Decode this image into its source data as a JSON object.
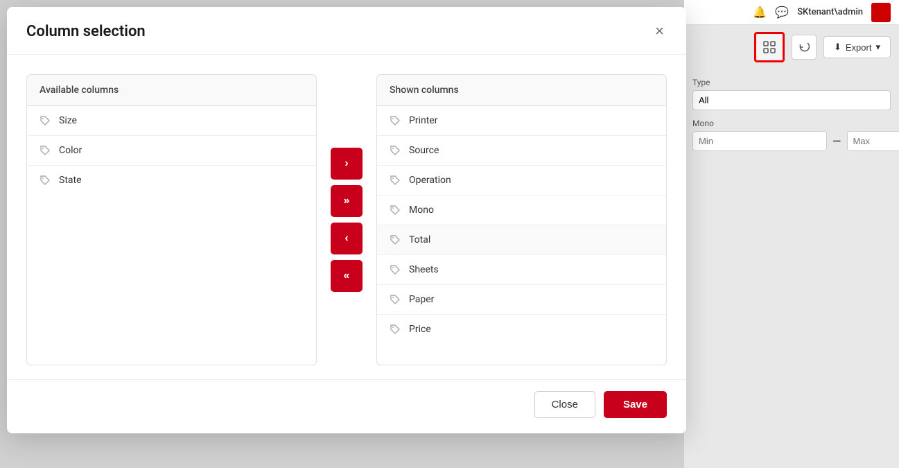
{
  "dialog": {
    "title": "Column selection",
    "close_label": "×"
  },
  "available_columns": {
    "header": "Available columns",
    "items": [
      {
        "label": "Size"
      },
      {
        "label": "Color"
      },
      {
        "label": "State"
      }
    ]
  },
  "shown_columns": {
    "header": "Shown columns",
    "items": [
      {
        "label": "Printer"
      },
      {
        "label": "Source"
      },
      {
        "label": "Operation"
      },
      {
        "label": "Mono"
      },
      {
        "label": "Total"
      },
      {
        "label": "Sheets"
      },
      {
        "label": "Paper"
      },
      {
        "label": "Price"
      }
    ]
  },
  "arrows": {
    "move_right": "›",
    "move_all_right": "»",
    "move_left": "‹",
    "move_all_left": "«"
  },
  "footer": {
    "close_label": "Close",
    "save_label": "Save"
  },
  "bg_panel": {
    "username": "SKtenant\\admin",
    "export_label": "Export",
    "filter_type_label": "Type",
    "filter_type_value": "All",
    "filter_mono_label": "Mono",
    "filter_min_placeholder": "Min",
    "filter_max_placeholder": "Max"
  }
}
